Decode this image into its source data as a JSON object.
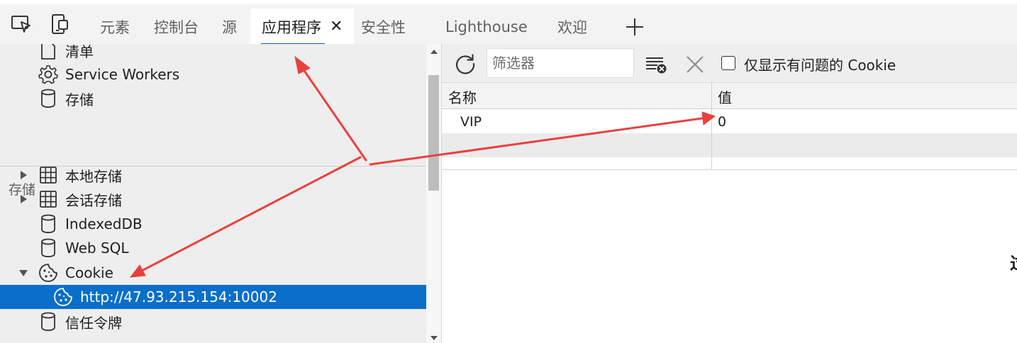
{
  "tabs": [
    {
      "label": "元素"
    },
    {
      "label": "控制台"
    },
    {
      "label": "源"
    },
    {
      "label": "应用程序",
      "active": true
    },
    {
      "label": "安全性"
    },
    {
      "label": "Lighthouse"
    },
    {
      "label": "欢迎"
    }
  ],
  "tab_close": "✕",
  "sidebar": {
    "app_items": [
      {
        "label": "清单",
        "icon": "file-icon"
      },
      {
        "label": "Service Workers",
        "icon": "gear-icon"
      },
      {
        "label": "存储",
        "icon": "database-icon"
      }
    ],
    "storage_section_title": "存储",
    "storage_items": [
      {
        "label": "本地存储",
        "icon": "grid-icon",
        "expander": "collapsed"
      },
      {
        "label": "会话存储",
        "icon": "grid-icon",
        "expander": "collapsed"
      },
      {
        "label": "IndexedDB",
        "icon": "database-icon"
      },
      {
        "label": "Web SQL",
        "icon": "database-icon"
      },
      {
        "label": "Cookie",
        "icon": "cookie-icon",
        "expander": "expanded"
      },
      {
        "label": "http://47.93.215.154:10002",
        "icon": "cookie-icon",
        "selected": true
      },
      {
        "label": "信任令牌",
        "icon": "database-icon"
      }
    ]
  },
  "toolbar": {
    "filter_placeholder": "筛选器",
    "only_issues_label": "仅显示有问题的 Cookie",
    "only_issues_checked": false
  },
  "cookie_table": {
    "columns": [
      "名称",
      "值"
    ],
    "rows": [
      {
        "name": "VIP",
        "value": "0"
      }
    ]
  },
  "edge_glyph": "过",
  "colors": {
    "accent": "#0b66c3",
    "selection": "#0a6fc9",
    "annotation_arrow": "#e8413d"
  }
}
